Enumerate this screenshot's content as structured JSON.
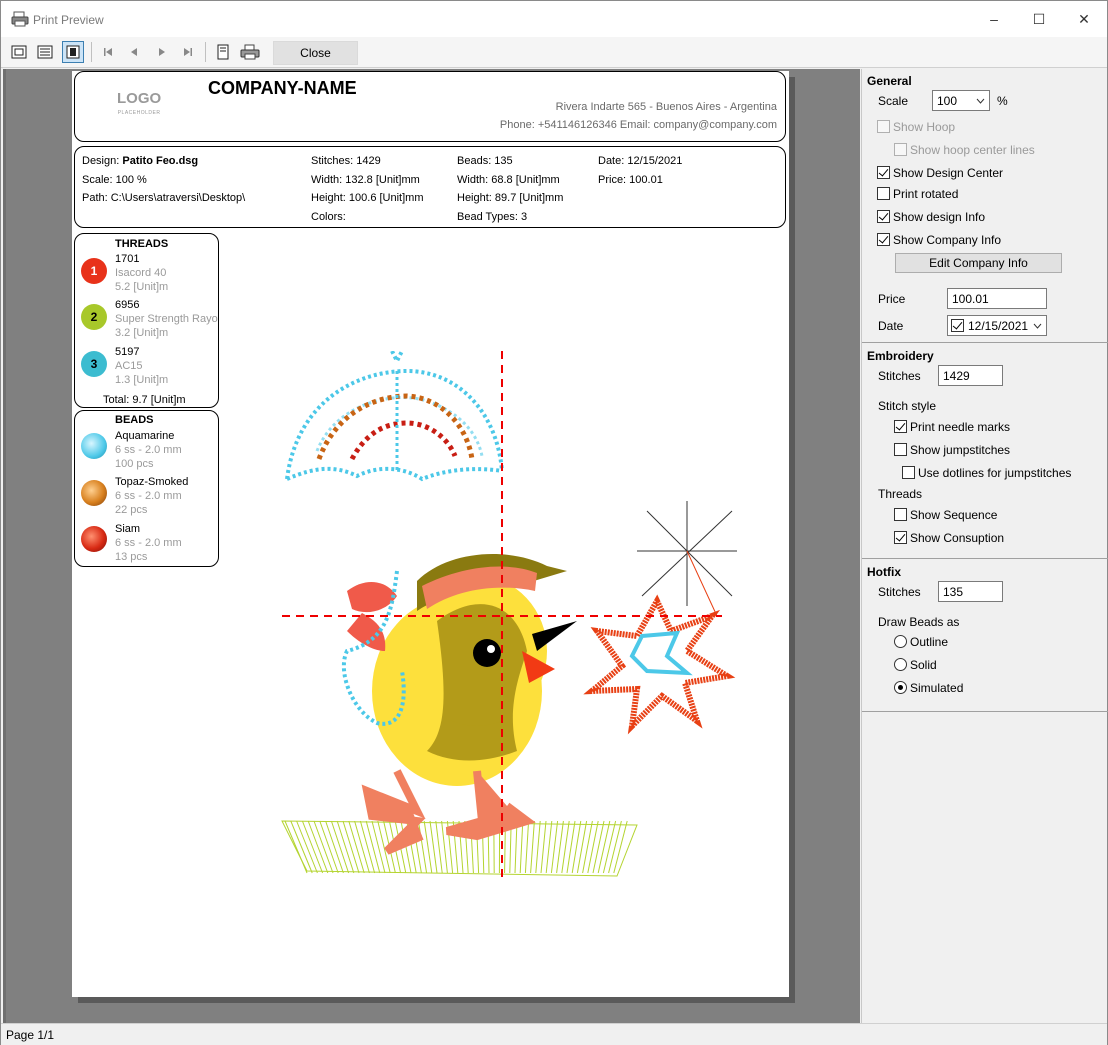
{
  "window": {
    "title": "Print Preview",
    "minimize": "–",
    "maximize": "☐",
    "close": "✕"
  },
  "toolbar": {
    "close_label": "Close"
  },
  "page": {
    "logo": "LOGO",
    "logo_sub": "PLACEHOLDER",
    "company_name": "COMPANY-NAME",
    "address": "Rivera Indarte 565 - Buenos Aires - Argentina",
    "contact": "Phone: +541146126346  Email: company@company.com",
    "design_label": "Design:",
    "design_name": "Patito Feo.dsg",
    "scale": "Scale: 100 %",
    "path": "Path: C:\\Users\\atraversi\\Desktop\\",
    "stitches": "Stitches: 1429",
    "width": "Width: 132.8 [Unit]mm",
    "height": "Height: 100.6 [Unit]mm",
    "colors": "Colors:",
    "beads": "Beads: 135",
    "bead_width": "Width: 68.8 [Unit]mm",
    "bead_height": "Height: 89.7 [Unit]mm",
    "bead_types": "Bead Types: 3",
    "date": "Date: 12/15/2021",
    "price": "Price: 100.01",
    "threads_title": "THREADS",
    "threads": [
      {
        "num": "1",
        "code": "1701",
        "name": "Isacord 40",
        "len": "5.2 [Unit]m",
        "color": "#e8321a"
      },
      {
        "num": "2",
        "code": "6956",
        "name": "Super Strength Rayo",
        "len": "3.2 [Unit]m",
        "color": "#a8c82a"
      },
      {
        "num": "3",
        "code": "5197",
        "name": "AC15",
        "len": "1.3 [Unit]m",
        "color": "#3cbcd0"
      }
    ],
    "threads_total": "Total: 9.7 [Unit]m",
    "beads_title": "BEADS",
    "bead_list": [
      {
        "name": "Aquamarine",
        "size": "6 ss - 2.0 mm",
        "count": "100 pcs",
        "color": "#4cc8e8"
      },
      {
        "name": "Topaz-Smoked",
        "size": "6 ss - 2.0 mm",
        "count": "22 pcs",
        "color": "#c86414"
      },
      {
        "name": "Siam",
        "size": "6 ss - 2.0 mm",
        "count": "13 pcs",
        "color": "#c81e14"
      }
    ]
  },
  "panel": {
    "general": "General",
    "scale_label": "Scale",
    "scale_value": "100",
    "scale_unit": "%",
    "show_hoop": "Show Hoop",
    "show_hoop_center": "Show hoop center lines",
    "show_design_center": "Show Design Center",
    "print_rotated": "Print rotated",
    "show_design_info": "Show design Info",
    "show_company_info": "Show Company Info",
    "edit_company_info": "Edit Company Info",
    "price_label": "Price",
    "price_value": "100.01",
    "date_label": "Date",
    "date_value": "12/15/2021",
    "embroidery": "Embroidery",
    "stitches_label": "Stitches",
    "emb_stitches": "1429",
    "stitch_style": "Stitch style",
    "print_needle": "Print needle marks",
    "show_jump": "Show jumpstitches",
    "use_dotlines": "Use dotlines for jumpstitches",
    "threads": "Threads",
    "show_sequence": "Show Sequence",
    "show_consumption": "Show Consuption",
    "hotfix": "Hotfix",
    "hotfix_stitches_label": "Stitches",
    "hotfix_stitches": "135",
    "draw_beads_as": "Draw Beads as",
    "outline": "Outline",
    "solid": "Solid",
    "simulated": "Simulated"
  },
  "status": {
    "page": "Page 1/1"
  }
}
